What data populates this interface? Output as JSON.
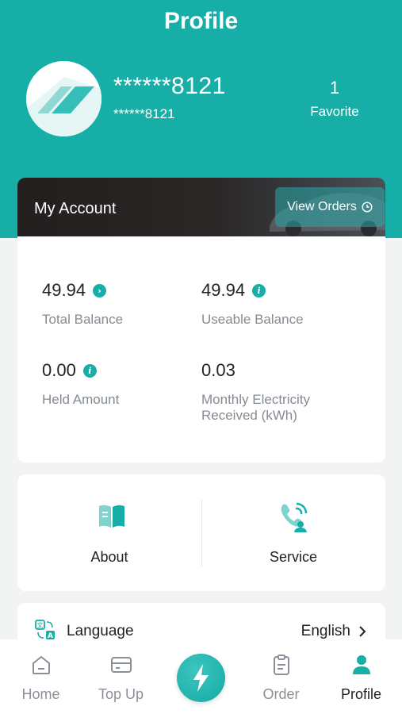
{
  "header": {
    "title": "Profile",
    "username_main": "******8121",
    "username_sub": "******8121",
    "favorite_count": "1",
    "favorite_label": "Favorite"
  },
  "account": {
    "title": "My Account",
    "view_orders_label": "View Orders",
    "stats": [
      {
        "value": "49.94",
        "label": "Total Balance",
        "icon": "chevron-right-icon"
      },
      {
        "value": "49.94",
        "label": "Useable Balance",
        "icon": "info-icon"
      },
      {
        "value": "0.00",
        "label": "Held Amount",
        "icon": "info-icon"
      },
      {
        "value": "0.03",
        "label_line1": "Monthly Electricity",
        "label_line2": "Received (kWh)"
      }
    ]
  },
  "quick_links": [
    {
      "label": "About",
      "icon": "book-icon"
    },
    {
      "label": "Service",
      "icon": "phone-support-icon"
    }
  ],
  "language": {
    "label": "Language",
    "value": "English"
  },
  "tabbar": {
    "items": [
      {
        "label": "Home",
        "icon": "home-icon"
      },
      {
        "label": "Top Up",
        "icon": "card-icon"
      },
      {
        "label": "",
        "icon": "lightning-icon"
      },
      {
        "label": "Order",
        "icon": "clipboard-icon"
      },
      {
        "label": "Profile",
        "icon": "user-icon"
      }
    ],
    "active": "Profile"
  },
  "colors": {
    "brand": "#18aea8",
    "label_gray": "#858b92"
  }
}
